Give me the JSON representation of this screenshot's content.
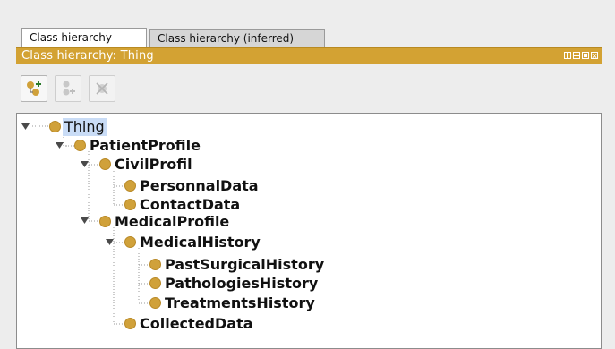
{
  "tabs": [
    {
      "label": "Class hierarchy",
      "active": true
    },
    {
      "label": "Class hierarchy (inferred)",
      "active": false
    }
  ],
  "panel": {
    "title": "Class hierarchy: Thing",
    "accent_color": "#d3a233"
  },
  "toolbar": {
    "buttons": [
      {
        "name": "add-subclass-icon",
        "enabled": true
      },
      {
        "name": "add-sibling-icon",
        "enabled": false
      },
      {
        "name": "delete-class-icon",
        "enabled": false
      }
    ]
  },
  "tree": {
    "bullet_color": "#d0a13a",
    "nodes": [
      {
        "label": "Thing",
        "depth": 0,
        "expanded": true,
        "selected": true
      },
      {
        "label": "PatientProfile",
        "depth": 1,
        "expanded": true
      },
      {
        "label": "CivilProfil",
        "depth": 2,
        "expanded": true
      },
      {
        "label": "PersonnalData",
        "depth": 3
      },
      {
        "label": "ContactData",
        "depth": 3
      },
      {
        "label": "MedicalProfile",
        "depth": 2,
        "expanded": true
      },
      {
        "label": "MedicalHistory",
        "depth": 3,
        "expanded": true
      },
      {
        "label": "PastSurgicalHistory",
        "depth": 4
      },
      {
        "label": "PathologiesHistory",
        "depth": 4
      },
      {
        "label": "TreatmentsHistory",
        "depth": 4
      },
      {
        "label": "CollectedData",
        "depth": 3
      }
    ]
  }
}
